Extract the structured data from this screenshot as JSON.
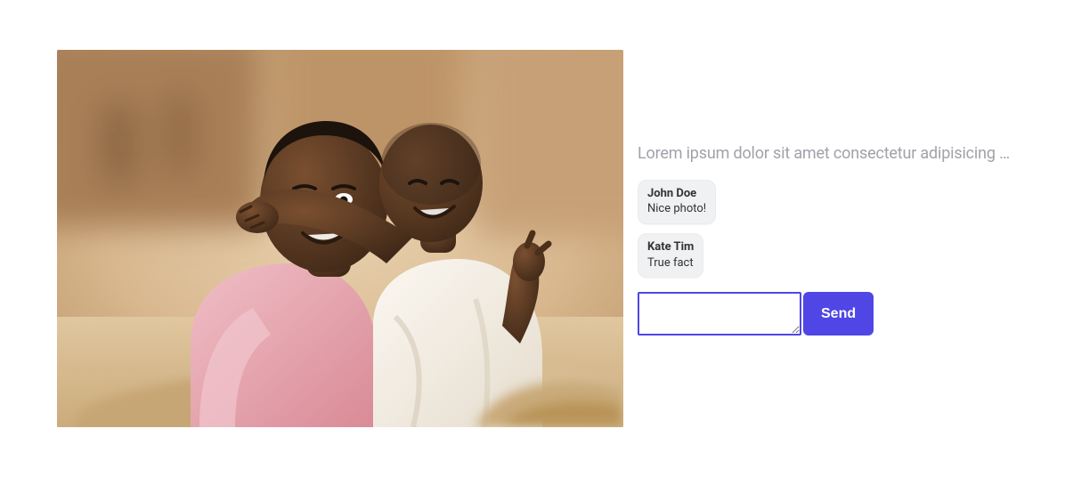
{
  "caption": "Lorem ipsum dolor sit amet consectetur adipisicing elit",
  "comments": [
    {
      "author": "John Doe",
      "text": "Nice photo!"
    },
    {
      "author": "Kate Tim",
      "text": "True fact"
    }
  ],
  "compose": {
    "value": "",
    "send_label": "Send"
  },
  "image": {
    "alt": "Two young children smiling and hugging outdoors; one in a pink shirt, one in a white shirt",
    "palette": {
      "bg_warm": "#dcc09a",
      "bg_blur": "#b28b5d",
      "skin": "#5a3a24",
      "skin_hi": "#7a5333",
      "pink_shirt": "#e7a9b2",
      "white_shirt": "#f3ede3",
      "sand": "#d6bb90"
    }
  }
}
